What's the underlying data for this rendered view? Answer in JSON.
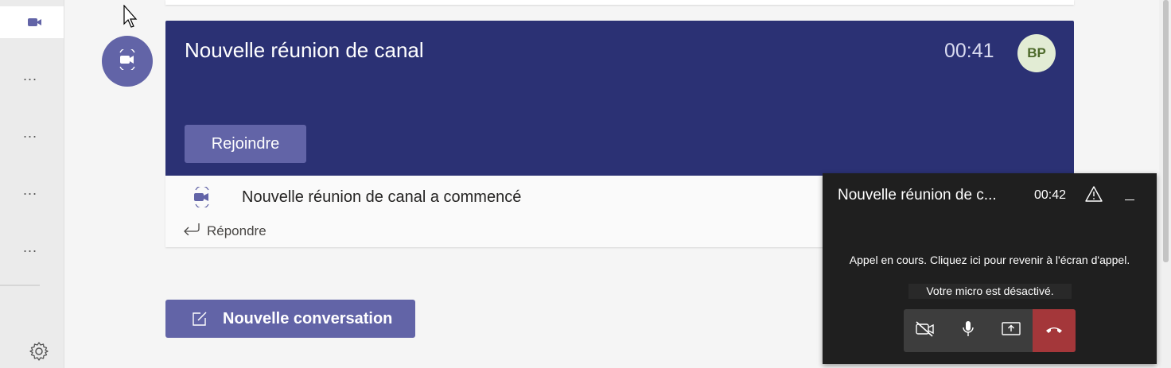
{
  "rail": {
    "items": [
      {
        "icon": "video-camera-icon",
        "active": true
      },
      {
        "label": "..."
      },
      {
        "label": "..."
      },
      {
        "label": "..."
      },
      {
        "label": "..."
      }
    ],
    "settings_icon": "gear-icon"
  },
  "meeting_card": {
    "title": "Nouvelle réunion de canal",
    "elapsed": "00:41",
    "avatar_initials": "BP",
    "join_label": "Rejoindre",
    "started_text": "Nouvelle réunion de canal a commencé",
    "reply_label": "Répondre"
  },
  "new_conversation_label": "Nouvelle conversation",
  "call_panel": {
    "title": "Nouvelle réunion de c...",
    "elapsed": "00:42",
    "message": "Appel en cours. Cliquez ici pour revenir à l'écran d'appel.",
    "mic_status": "Votre micro est désactivé.",
    "controls": [
      "video-off-icon",
      "microphone-icon",
      "share-screen-icon",
      "hang-up-icon"
    ]
  },
  "colors": {
    "brand": "#6264a7",
    "banner": "#2b3174",
    "hangup": "#a4373a",
    "panel": "#1f1f1f"
  }
}
